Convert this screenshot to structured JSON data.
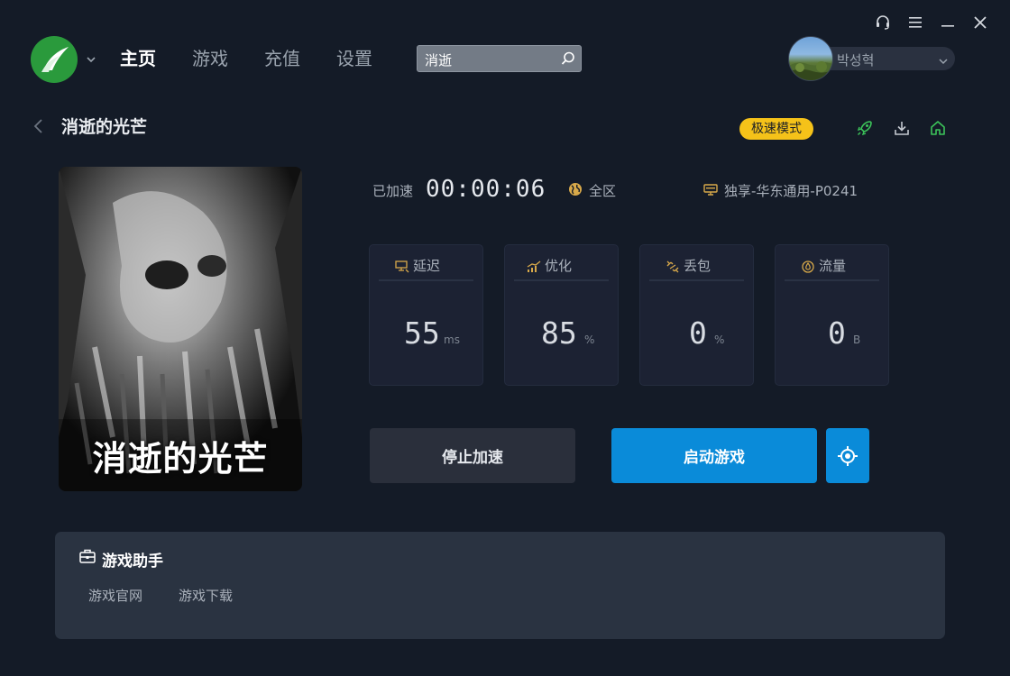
{
  "nav": {
    "items": [
      {
        "label": "主页",
        "active": true
      },
      {
        "label": "游戏",
        "active": false
      },
      {
        "label": "充值",
        "active": false
      },
      {
        "label": "设置",
        "active": false
      }
    ]
  },
  "search": {
    "value": "消逝"
  },
  "user": {
    "name": "박성혁"
  },
  "game": {
    "title": "消逝的光芒",
    "cover_text": "消逝的光芒",
    "mode_badge": "极速模式"
  },
  "status": {
    "elapsed_label": "已加速",
    "elapsed_time": "00:00:06",
    "region": "全区",
    "server": "独享-华东通用-P0241"
  },
  "stats": [
    {
      "label": "延迟",
      "value": "55",
      "unit": "ms",
      "icon": "latency-icon"
    },
    {
      "label": "优化",
      "value": "85",
      "unit": "%",
      "icon": "signal-icon"
    },
    {
      "label": "丢包",
      "value": "0",
      "unit": "%",
      "icon": "broken-link-icon"
    },
    {
      "label": "流量",
      "value": "0",
      "unit": "B",
      "icon": "droplet-icon"
    }
  ],
  "buttons": {
    "stop": "停止加速",
    "launch": "启动游戏"
  },
  "helper": {
    "title": "游戏助手",
    "links": [
      "游戏官网",
      "游戏下载"
    ]
  },
  "colors": {
    "background": "#141b27",
    "accent_blue": "#0a8bd9",
    "badge_yellow": "#f5c219",
    "icon_green": "#3cc45a"
  }
}
